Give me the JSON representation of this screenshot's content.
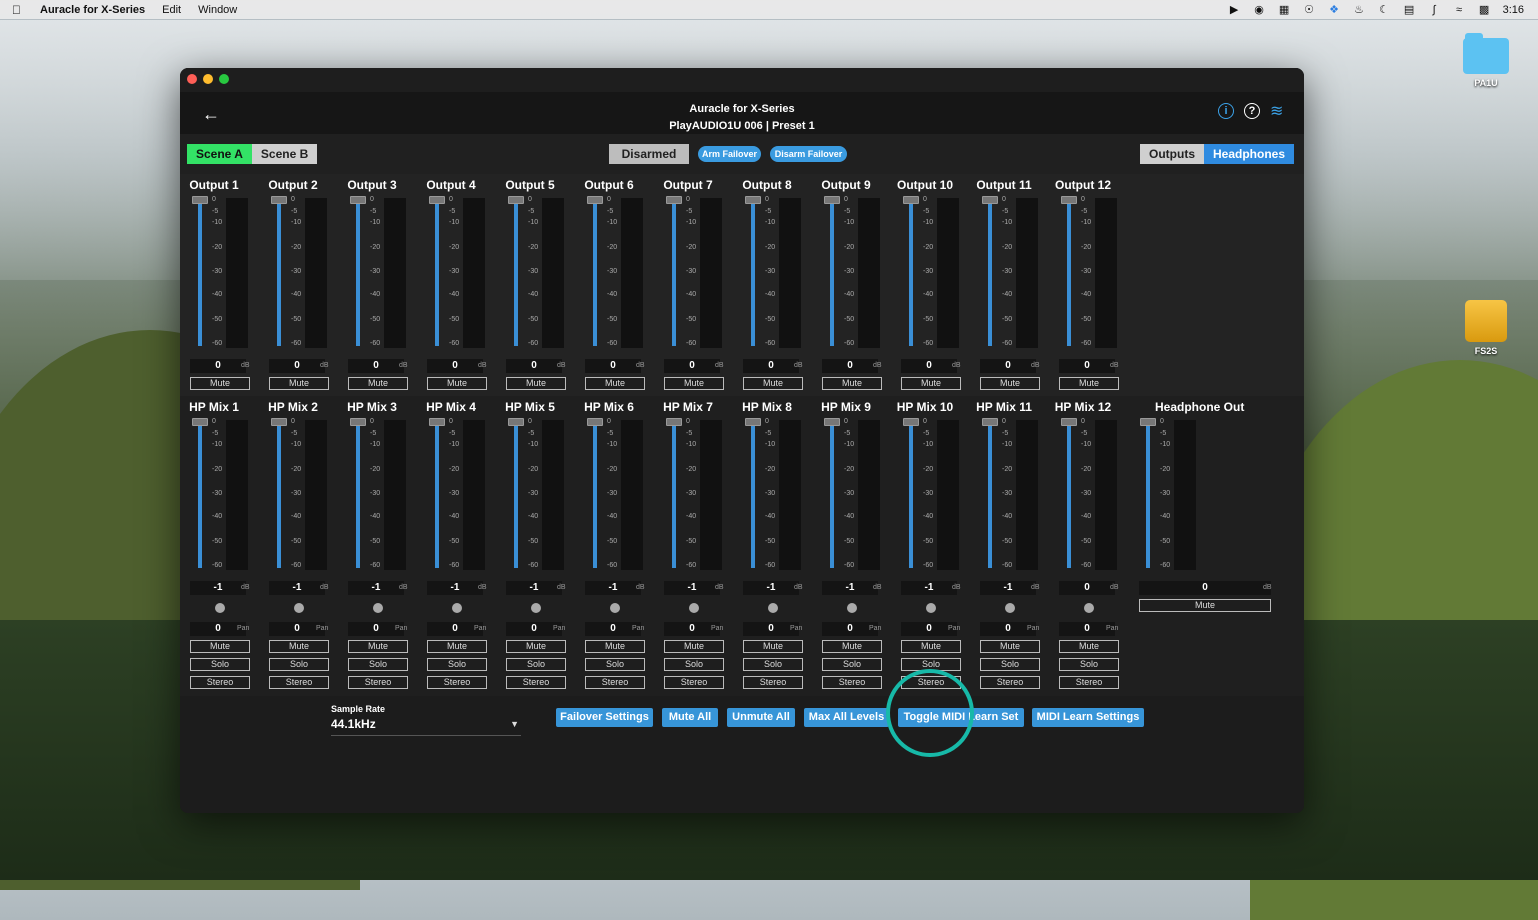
{
  "menubar": {
    "app_name": "Auracle for X-Series",
    "items": [
      "Edit",
      "Window"
    ],
    "clock": "3:16"
  },
  "desktop": {
    "icons": [
      {
        "label": "PA1U"
      },
      {
        "label": "FS2S"
      }
    ]
  },
  "window": {
    "title_line1": "Auracle for X-Series",
    "title_line2": "PlayAUDIO1U 006  |  Preset 1"
  },
  "toolbar": {
    "scene_a": "Scene A",
    "scene_b": "Scene B",
    "failover_state": "Disarmed",
    "arm_failover": "Arm Failover",
    "disarm_failover": "Disarm Failover",
    "outputs_tab": "Outputs",
    "headphones_tab": "Headphones"
  },
  "scale_labels": [
    "0",
    "-5",
    "-10",
    "-20",
    "-30",
    "-40",
    "-50",
    "-60"
  ],
  "units": {
    "db": "dB",
    "pan": "Pan"
  },
  "buttons": {
    "mute": "Mute",
    "solo": "Solo",
    "stereo": "Stereo"
  },
  "outputs": [
    {
      "name": "Output 1",
      "value": "0"
    },
    {
      "name": "Output 2",
      "value": "0"
    },
    {
      "name": "Output 3",
      "value": "0"
    },
    {
      "name": "Output 4",
      "value": "0"
    },
    {
      "name": "Output 5",
      "value": "0"
    },
    {
      "name": "Output 6",
      "value": "0"
    },
    {
      "name": "Output 7",
      "value": "0"
    },
    {
      "name": "Output 8",
      "value": "0"
    },
    {
      "name": "Output 9",
      "value": "0"
    },
    {
      "name": "Output 10",
      "value": "0"
    },
    {
      "name": "Output 11",
      "value": "0"
    },
    {
      "name": "Output 12",
      "value": "0"
    }
  ],
  "hp_mixes": [
    {
      "name": "HP Mix 1",
      "value": "-1",
      "pan": "0"
    },
    {
      "name": "HP Mix 2",
      "value": "-1",
      "pan": "0"
    },
    {
      "name": "HP Mix 3",
      "value": "-1",
      "pan": "0"
    },
    {
      "name": "HP Mix 4",
      "value": "-1",
      "pan": "0"
    },
    {
      "name": "HP Mix 5",
      "value": "-1",
      "pan": "0"
    },
    {
      "name": "HP Mix 6",
      "value": "-1",
      "pan": "0"
    },
    {
      "name": "HP Mix 7",
      "value": "-1",
      "pan": "0"
    },
    {
      "name": "HP Mix 8",
      "value": "-1",
      "pan": "0"
    },
    {
      "name": "HP Mix 9",
      "value": "-1",
      "pan": "0"
    },
    {
      "name": "HP Mix 10",
      "value": "-1",
      "pan": "0"
    },
    {
      "name": "HP Mix 11",
      "value": "-1",
      "pan": "0"
    },
    {
      "name": "HP Mix 12",
      "value": "0",
      "pan": "0"
    }
  ],
  "headphone_out": {
    "name": "Headphone Out",
    "value": "0"
  },
  "footer": {
    "sample_rate_label": "Sample Rate",
    "sample_rate_value": "44.1kHz",
    "failover_settings": "Failover Settings",
    "mute_all": "Mute All",
    "unmute_all": "Unmute All",
    "max_all_levels": "Max All Levels",
    "toggle_midi_learn": "Toggle MIDI Learn Set",
    "midi_learn_settings": "MIDI Learn Settings"
  },
  "colors": {
    "accent": "#3a9be0",
    "scene_active": "#33e266"
  }
}
